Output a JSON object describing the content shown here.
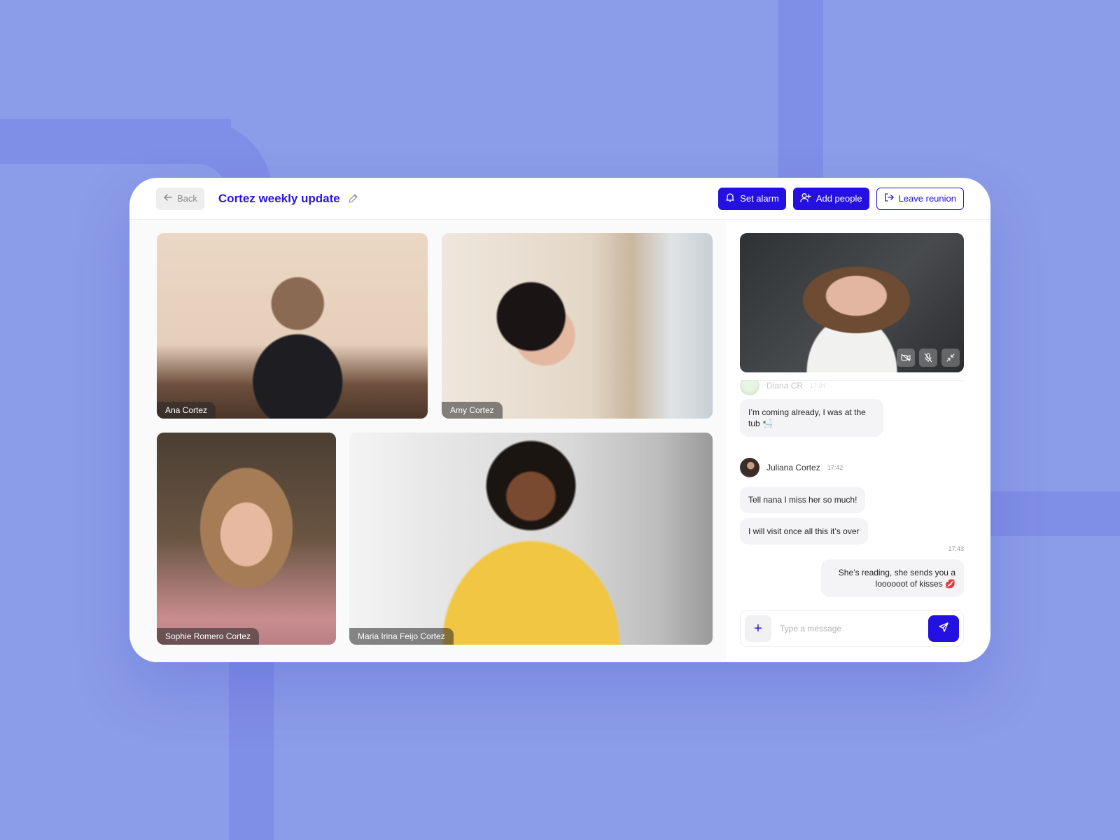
{
  "header": {
    "back_label": "Back",
    "title": "Cortez weekly update",
    "set_alarm_label": "Set alarm",
    "add_people_label": "Add people",
    "leave_label": "Leave reunion"
  },
  "participants": [
    {
      "name": "Ana Cortez"
    },
    {
      "name": "Amy Cortez"
    },
    {
      "name": "Sophie Romero Cortez"
    },
    {
      "name": "Maria Irina Feijo Cortez"
    }
  ],
  "chat": {
    "messages": [
      {
        "sender": "Diana CR",
        "time": "17:34",
        "text": "I’m coming already, I was at the tub 🛀"
      },
      {
        "sender": "Juliana Cortez",
        "time": "17:42",
        "text": "Tell nana I miss her so much!"
      },
      {
        "sender": "Juliana Cortez",
        "time": "17:42",
        "text": "I will visit once all this it’s over"
      },
      {
        "sender": "me",
        "time": "17:43",
        "text": "She’s reading, she sends you a loooooot of kisses 💋"
      }
    ],
    "composer_placeholder": "Type a message"
  },
  "colors": {
    "accent": "#2410e0",
    "background": "#8b9ce8"
  },
  "icons": {
    "back": "arrow-left-icon",
    "edit": "pencil-icon",
    "alarm": "bell-icon",
    "add_people": "user-plus-icon",
    "leave": "logout-icon",
    "camera_off": "video-off-icon",
    "mic_off": "mic-off-icon",
    "minimize": "minimize-icon",
    "add": "plus-icon",
    "send": "send-icon"
  }
}
